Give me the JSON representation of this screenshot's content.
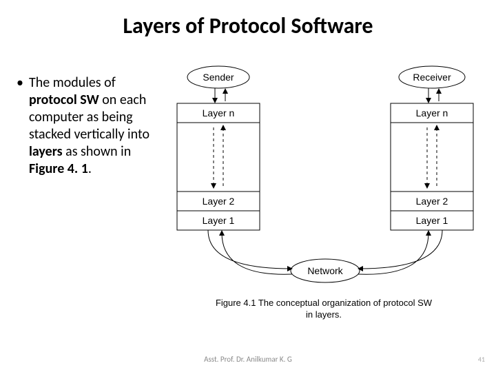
{
  "title": "Layers of Protocol Software",
  "bullet": {
    "pre": "The modules of ",
    "bold1": "protocol SW",
    "mid1": " on each computer as being stacked vertically into ",
    "bold2": "layers",
    "mid2": " as shown in ",
    "bold3": "Figure 4. 1",
    "end": "."
  },
  "diagram": {
    "sender": "Sender",
    "receiver": "Receiver",
    "layer_n": "Layer n",
    "layer_2": "Layer 2",
    "layer_1": "Layer 1",
    "network": "Network"
  },
  "caption_line1": "Figure 4.1  The conceptual organization of protocol SW",
  "caption_line2": "in layers.",
  "footer": "Asst. Prof. Dr. Anilkumar K. G",
  "page": "41"
}
